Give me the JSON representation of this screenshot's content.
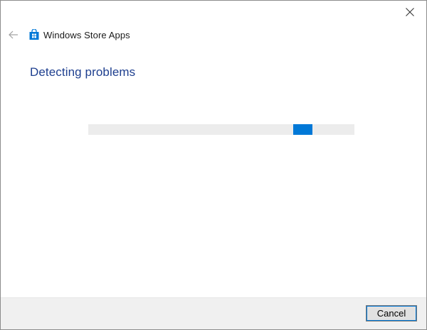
{
  "window": {
    "app_title": "Windows Store Apps",
    "heading": "Detecting problems"
  },
  "icons": {
    "close": "close-icon",
    "back": "back-arrow-icon",
    "app": "store-bag-icon"
  },
  "progress": {
    "mode": "indeterminate",
    "track_color": "#ececec",
    "fill_color": "#0078d7"
  },
  "footer": {
    "cancel_label": "Cancel"
  },
  "colors": {
    "heading": "#1e3f8f",
    "accent": "#0078d7",
    "footer_bg": "#f0f0f0"
  }
}
